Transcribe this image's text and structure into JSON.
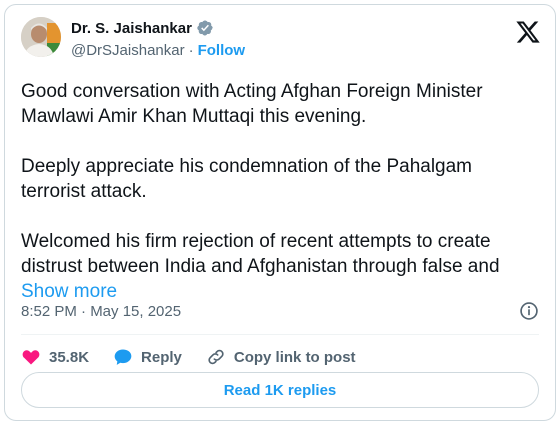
{
  "header": {
    "name": "Dr. S. Jaishankar",
    "handle": "@DrSJaishankar",
    "separator": "·",
    "follow_label": "Follow"
  },
  "tweet": {
    "paragraphs": [
      "Good conversation with Acting Afghan Foreign Minister Mawlawi Amir Khan Muttaqi this evening.",
      "Deeply appreciate his condemnation of the Pahalgam terrorist attack.",
      "Welcomed his firm rejection of recent attempts to create distrust between India and Afghanistan through false and"
    ],
    "show_more_label": "Show more"
  },
  "meta": {
    "timestamp": "8:52 PM · May 15, 2025"
  },
  "actions": {
    "like_count": "35.8K",
    "reply_label": "Reply",
    "copy_link_label": "Copy link to post"
  },
  "read_replies_label": "Read 1K replies",
  "colors": {
    "accent": "#1d9bf0",
    "like": "#f91880",
    "text": "#0f1419",
    "secondary": "#536471",
    "border": "#cfd9de"
  }
}
